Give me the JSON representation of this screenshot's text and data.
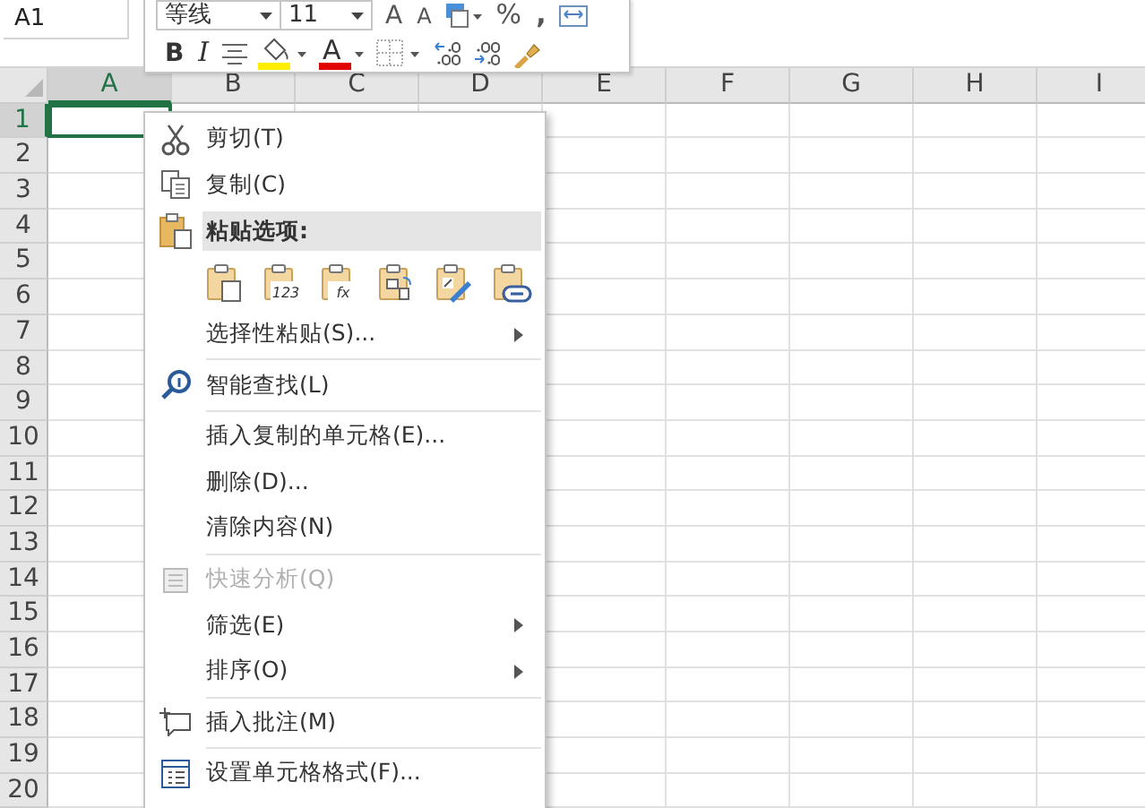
{
  "name_box": "A1",
  "columns": [
    {
      "label": "A",
      "selected": true
    },
    {
      "label": "B",
      "selected": false
    },
    {
      "label": "C",
      "selected": false
    },
    {
      "label": "D",
      "selected": false
    },
    {
      "label": "E",
      "selected": false
    },
    {
      "label": "F",
      "selected": false
    },
    {
      "label": "G",
      "selected": false
    },
    {
      "label": "H",
      "selected": false
    },
    {
      "label": "I",
      "selected": false
    }
  ],
  "rows": [
    {
      "label": "1",
      "selected": true
    },
    {
      "label": "2",
      "selected": false
    },
    {
      "label": "3",
      "selected": false
    },
    {
      "label": "4",
      "selected": false
    },
    {
      "label": "5",
      "selected": false
    },
    {
      "label": "6",
      "selected": false
    },
    {
      "label": "7",
      "selected": false
    },
    {
      "label": "8",
      "selected": false
    },
    {
      "label": "9",
      "selected": false
    },
    {
      "label": "10",
      "selected": false
    },
    {
      "label": "11",
      "selected": false
    },
    {
      "label": "12",
      "selected": false
    },
    {
      "label": "13",
      "selected": false
    },
    {
      "label": "14",
      "selected": false
    },
    {
      "label": "15",
      "selected": false
    },
    {
      "label": "16",
      "selected": false
    },
    {
      "label": "17",
      "selected": false
    },
    {
      "label": "18",
      "selected": false
    },
    {
      "label": "19",
      "selected": false
    },
    {
      "label": "20",
      "selected": false
    }
  ],
  "mini_toolbar": {
    "font": "等线",
    "size": "11",
    "grow_font": "A",
    "shrink_font": "A",
    "percent": "%",
    "comma": ",",
    "bold": "B",
    "italic": "I",
    "font_color": "A"
  },
  "context_menu": [
    {
      "kind": "command",
      "label": "剪切(T)",
      "disabled": false,
      "submenu": false
    },
    {
      "kind": "command",
      "label": "复制(C)",
      "disabled": false,
      "submenu": false
    },
    {
      "kind": "header",
      "label": "粘贴选项:"
    },
    {
      "kind": "paste-options",
      "options": [
        {
          "kind": "plain"
        },
        {
          "kind": "text",
          "text": "123"
        },
        {
          "kind": "text",
          "text": "fx"
        },
        {
          "kind": "transpose"
        },
        {
          "kind": "format"
        },
        {
          "kind": "link"
        }
      ]
    },
    {
      "kind": "command",
      "label": "选择性粘贴(S)...",
      "disabled": false,
      "submenu": true
    },
    {
      "kind": "separator"
    },
    {
      "kind": "command",
      "label": "智能查找(L)",
      "disabled": false,
      "submenu": false
    },
    {
      "kind": "separator"
    },
    {
      "kind": "command",
      "label": "插入复制的单元格(E)...",
      "disabled": false,
      "submenu": false
    },
    {
      "kind": "command",
      "label": "删除(D)...",
      "disabled": false,
      "submenu": false
    },
    {
      "kind": "command",
      "label": "清除内容(N)",
      "disabled": false,
      "submenu": false
    },
    {
      "kind": "separator"
    },
    {
      "kind": "command",
      "label": "快速分析(Q)",
      "disabled": true,
      "submenu": false
    },
    {
      "kind": "command",
      "label": "筛选(E)",
      "disabled": false,
      "submenu": true
    },
    {
      "kind": "command",
      "label": "排序(O)",
      "disabled": false,
      "submenu": true
    },
    {
      "kind": "separator"
    },
    {
      "kind": "command",
      "label": "插入批注(M)",
      "disabled": false,
      "submenu": false
    },
    {
      "kind": "separator"
    },
    {
      "kind": "command",
      "label": "设置单元格格式(F)...",
      "disabled": false,
      "submenu": false
    }
  ]
}
